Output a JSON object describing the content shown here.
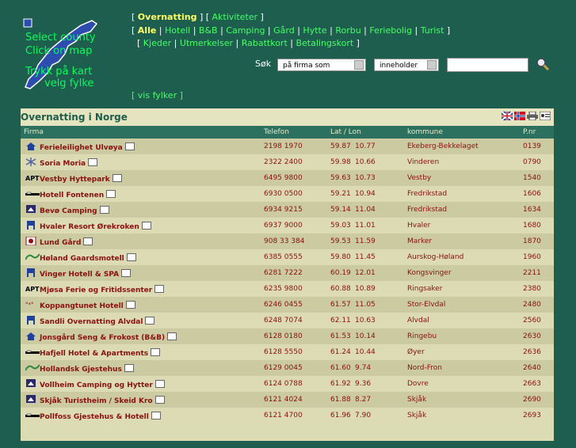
{
  "map": {
    "select_county": "Select county",
    "click_on_map": "Click on map",
    "trykk_pa_kart": "Trykk på kart",
    "velg_fylke": "velg fylke"
  },
  "nav": {
    "row1": {
      "open": "[ ",
      "active": "Overnatting",
      "mid": " ] [ ",
      "link": "Aktiviteter",
      "close": " ]"
    },
    "row2": {
      "open": "[ ",
      "active": "Alle",
      "links": [
        "Hotell",
        "B&B",
        "Camping",
        "Gård",
        "Hytte",
        "Rorbu",
        "Feriebolig",
        "Turist"
      ],
      "close": " ]"
    },
    "row3": {
      "open": "[ ",
      "links": [
        "Kjeder",
        "Utmerkelser",
        "Rabattkort",
        "Betalingskort"
      ],
      "close": " ]"
    },
    "vis_fylker": "[ vis fylker ]"
  },
  "search": {
    "label": "Søk",
    "field_select": "på firma som",
    "match_select": "inneholder",
    "query_value": ""
  },
  "panel": {
    "title": "Overnatting i Norge",
    "columns": {
      "firma": "Firma",
      "telefon": "Telefon",
      "latlon": "Lat / Lon",
      "kommune": "kommune",
      "pnr": "P.nr"
    }
  },
  "rows": [
    {
      "name": "Ferieleilighet Ulvøya",
      "tel": "2198 1970",
      "lat": "59.87",
      "lon": "10.77",
      "kommune": "Ekeberg-Bekkelaget",
      "pnr": "0139",
      "icon": "house-icon"
    },
    {
      "name": "Soria Moria",
      "tel": "2322 2400",
      "lat": "59.98",
      "lon": "10.66",
      "kommune": "Vinderen",
      "pnr": "0790",
      "icon": "snowflake-icon"
    },
    {
      "name": "Vestby Hyttepark",
      "tel": "6495 9800",
      "lat": "59.63",
      "lon": "10.73",
      "kommune": "Vestby",
      "pnr": "1540",
      "icon": "apt-icon"
    },
    {
      "name": "Hotell Fontenen",
      "tel": "6930 0500",
      "lat": "59.21",
      "lon": "10.94",
      "kommune": "Fredrikstad",
      "pnr": "1606",
      "icon": "bed-icon"
    },
    {
      "name": "Bevø Camping",
      "tel": "6934 9215",
      "lat": "59.14",
      "lon": "11.04",
      "kommune": "Fredrikstad",
      "pnr": "1634",
      "icon": "camping-icon"
    },
    {
      "name": "Hvaler Resort Ørekroken",
      "tel": "6937 9000",
      "lat": "59.03",
      "lon": "11.01",
      "kommune": "Hvaler",
      "pnr": "1680",
      "icon": "chair-icon"
    },
    {
      "name": "Lund Gård",
      "tel": "908 33 384",
      "lat": "59.53",
      "lon": "11.59",
      "kommune": "Marker",
      "pnr": "1870",
      "icon": "farm-icon"
    },
    {
      "name": "Høland Gaardsmotell",
      "tel": "6385 0555",
      "lat": "59.80",
      "lon": "11.45",
      "kommune": "Aurskog-Høland",
      "pnr": "1960",
      "icon": "motel-icon"
    },
    {
      "name": "Vinger Hotell & SPA",
      "tel": "6281 7222",
      "lat": "60.19",
      "lon": "12.01",
      "kommune": "Kongsvinger",
      "pnr": "2211",
      "icon": "chair-icon"
    },
    {
      "name": "Mjøsa Ferie og Fritidssenter",
      "tel": "6235 9800",
      "lat": "60.88",
      "lon": "10.89",
      "kommune": "Ringsaker",
      "pnr": "2380",
      "icon": "apt-icon"
    },
    {
      "name": "Koppangtunet Hotell",
      "tel": "6246 0455",
      "lat": "61.57",
      "lon": "11.05",
      "kommune": "Stor-Elvdal",
      "pnr": "2480",
      "icon": "stars-icon"
    },
    {
      "name": "Sandli Overnatting Alvdal",
      "tel": "6248 7074",
      "lat": "62.11",
      "lon": "10.63",
      "kommune": "Alvdal",
      "pnr": "2560",
      "icon": "chair-icon"
    },
    {
      "name": "Jonsgård Seng & Frokost (B&B)",
      "tel": "6128 0180",
      "lat": "61.53",
      "lon": "10.14",
      "kommune": "Ringebu",
      "pnr": "2630",
      "icon": "house-icon"
    },
    {
      "name": "Hafjell Hotel & Apartments",
      "tel": "6128 5550",
      "lat": "61.24",
      "lon": "10.44",
      "kommune": "Øyer",
      "pnr": "2636",
      "icon": "bed-icon"
    },
    {
      "name": "Hollandsk Gjestehus",
      "tel": "6129 0045",
      "lat": "61.60",
      "lon": "9.74",
      "kommune": "Nord-Fron",
      "pnr": "2640",
      "icon": "motel-icon"
    },
    {
      "name": "Vollheim Camping og Hytter",
      "tel": "6124 0788",
      "lat": "61.92",
      "lon": "9.36",
      "kommune": "Dovre",
      "pnr": "2663",
      "icon": "camping-icon"
    },
    {
      "name": "Skjåk Turistheim / Skeid Kro",
      "tel": "6121 4024",
      "lat": "61.88",
      "lon": "8.27",
      "kommune": "Skjåk",
      "pnr": "2690",
      "icon": "camping-icon"
    },
    {
      "name": "Pollfoss Gjestehus & Hotell",
      "tel": "6121 4700",
      "lat": "61.96",
      "lon": "7.90",
      "kommune": "Skjåk",
      "pnr": "2693",
      "icon": "bed-icon"
    }
  ],
  "colors": {
    "background": "#1e5e4e",
    "link": "#44ff66",
    "active": "#ffff66",
    "row_text": "#8b1010"
  }
}
